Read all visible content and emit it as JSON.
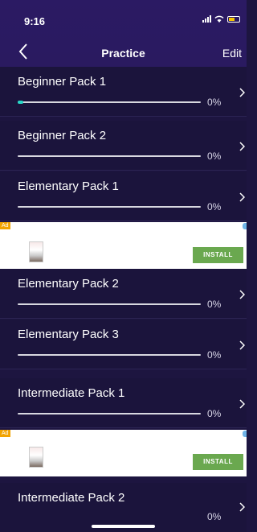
{
  "status_bar": {
    "time": "9:16"
  },
  "nav": {
    "title": "Practice",
    "edit_label": "Edit"
  },
  "packs": [
    {
      "label": "Beginner Pack 1",
      "percent_text": "0%",
      "progress": 0.03
    },
    {
      "label": "Beginner Pack 2",
      "percent_text": "0%",
      "progress": 0
    },
    {
      "label": "Elementary Pack 1",
      "percent_text": "0%",
      "progress": 0
    },
    {
      "label": "Elementary Pack 2",
      "percent_text": "0%",
      "progress": 0
    },
    {
      "label": "Elementary Pack 3",
      "percent_text": "0%",
      "progress": 0
    },
    {
      "label": "Intermediate Pack 1",
      "percent_text": "0%",
      "progress": 0
    },
    {
      "label": "Intermediate Pack 2",
      "percent_text": "0%",
      "progress": 0
    }
  ],
  "ads": [
    {
      "tag": "Ad",
      "button_label": "INSTALL"
    },
    {
      "tag": "Ad",
      "button_label": "INSTALL"
    }
  ],
  "colors": {
    "background": "#1b143c",
    "header": "#2b1a63",
    "progress_fill": "#28d8c8",
    "install_button": "#6aa84f",
    "ad_tag": "#f2a300"
  }
}
